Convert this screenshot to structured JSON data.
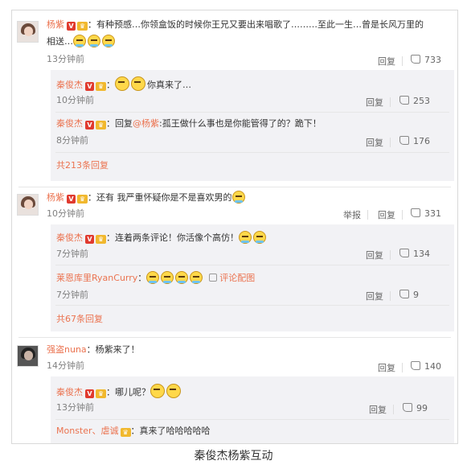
{
  "comments": [
    {
      "author": "杨紫",
      "text_line1": "：有种预感…你领盒饭的时候你王兄又要出来唱歌了………至此一生…曾是长风万里的",
      "text_line2": "相送…",
      "time": "13分钟前",
      "reply_label": "回复",
      "likes": "733",
      "replies": [
        {
          "author": "秦俊杰",
          "text": "你真来了…",
          "time": "10分钟前",
          "reply_label": "回复",
          "likes": "253"
        },
        {
          "author": "秦俊杰",
          "text_prefix": "：回复",
          "mention": "@杨紫",
          "text": ":孤王做什么事也是你能管得了的？跪下！",
          "time": "8分钟前",
          "reply_label": "回复",
          "likes": "176"
        }
      ],
      "more_label": "共213条回复"
    },
    {
      "author": "杨紫",
      "text": "：还有 我严重怀疑你是不是喜欢男的",
      "time": "10分钟前",
      "report_label": "举报",
      "reply_label": "回复",
      "likes": "331",
      "replies": [
        {
          "author": "秦俊杰",
          "text": "：连着两条评论！你活像个高仿！",
          "time": "7分钟前",
          "reply_label": "回复",
          "likes": "134"
        },
        {
          "author": "莱恩库里RyanCurry",
          "text": "：",
          "comment_pic_label": "评论配图",
          "time": "7分钟前",
          "reply_label": "回复",
          "likes": "9"
        }
      ],
      "more_label": "共67条回复"
    },
    {
      "author": "强盗nuna",
      "text": "：杨紫来了！",
      "time": "14分钟前",
      "reply_label": "回复",
      "likes": "140",
      "replies": [
        {
          "author": "秦俊杰",
          "text": "：哪儿呢？",
          "time": "13分钟前",
          "reply_label": "回复",
          "likes": "99"
        },
        {
          "author": "Monster、虐诚",
          "text": "：真来了哈哈哈哈哈",
          "time": "",
          "reply_label": "",
          "likes": ""
        }
      ]
    }
  ],
  "badges": {
    "verified": "V",
    "vip": "♛"
  },
  "colors": {
    "name": "#eb7350",
    "reply_bg": "#f2f2f5",
    "time": "#808080"
  },
  "caption": "秦俊杰杨紫互动"
}
